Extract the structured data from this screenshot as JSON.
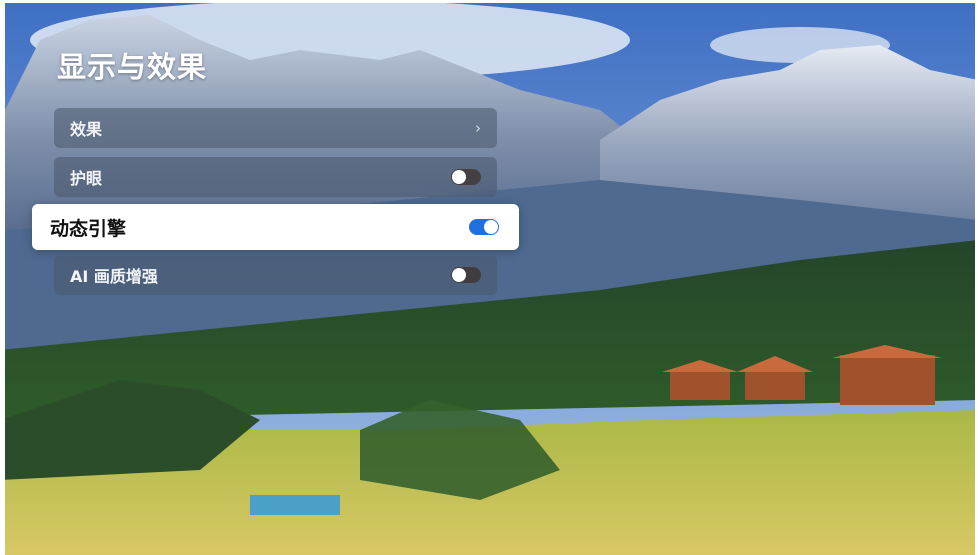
{
  "screen": {
    "title": "显示与效果"
  },
  "menu": {
    "items": [
      {
        "label": "效果",
        "control": "chevron",
        "chevron": "›"
      },
      {
        "label": "护眼",
        "control": "toggle",
        "on": false
      },
      {
        "label": "动态引擎",
        "control": "toggle",
        "on": true,
        "focused": true
      },
      {
        "label": "AI 画质增强",
        "control": "toggle",
        "on": false
      }
    ]
  },
  "colors": {
    "toggle_on": "#1f6fe0",
    "focus_bg": "#ffffff",
    "item_bg": "rgba(75,88,108,0.55)"
  },
  "background": {
    "description_icon": "mountain-landscape-image"
  }
}
